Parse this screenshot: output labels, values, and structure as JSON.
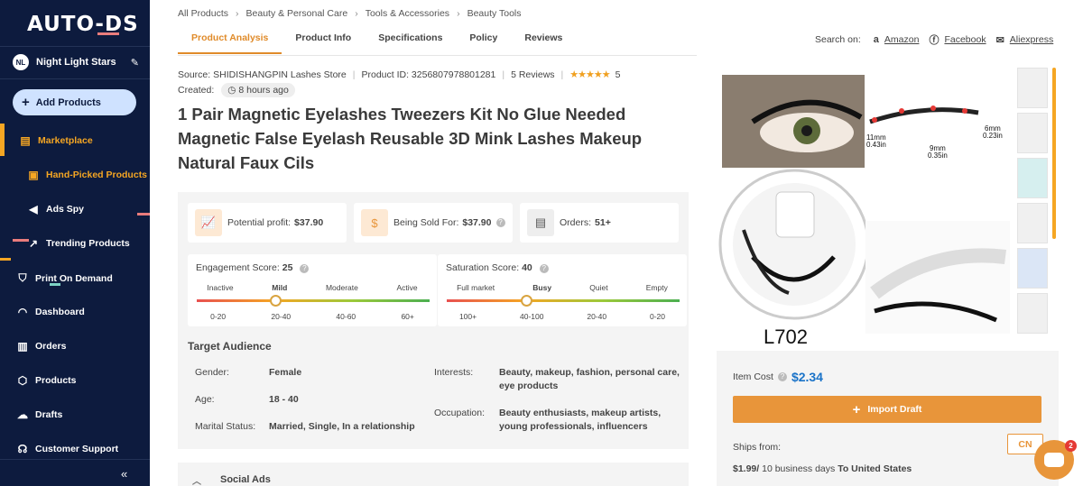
{
  "sidebar": {
    "logo": "AUTO-DS",
    "user": {
      "initials": "NL",
      "name": "Night Light Stars"
    },
    "add_products": "Add Products",
    "items": [
      {
        "label": "Marketplace",
        "icon": "store-icon"
      },
      {
        "label": "Hand-Picked Products",
        "icon": "box-star-icon"
      },
      {
        "label": "Ads Spy",
        "icon": "megaphone-icon"
      },
      {
        "label": "Trending Products",
        "icon": "trend-icon"
      },
      {
        "label": "Print On Demand",
        "icon": "shirt-icon"
      },
      {
        "label": "Dashboard",
        "icon": "gauge-icon"
      },
      {
        "label": "Orders",
        "icon": "orders-icon"
      },
      {
        "label": "Products",
        "icon": "cube-icon"
      },
      {
        "label": "Drafts",
        "icon": "cloud-upload-icon"
      },
      {
        "label": "Customer Support",
        "icon": "headset-icon"
      }
    ],
    "collapse": "«"
  },
  "breadcrumbs": [
    "All Products",
    "Beauty & Personal Care",
    "Tools & Accessories",
    "Beauty Tools"
  ],
  "tabs": [
    "Product Analysis",
    "Product Info",
    "Specifications",
    "Policy",
    "Reviews"
  ],
  "search_on": {
    "label": "Search on:",
    "links": [
      "Amazon",
      "Facebook",
      "Aliexpress"
    ]
  },
  "product": {
    "source": "Source: SHIDISHANGPIN Lashes Store",
    "product_id": "Product ID: 3256807978801281",
    "reviews": "5 Reviews",
    "rating": "5",
    "created_label": "Created:",
    "created_value": "8 hours ago",
    "title": "1 Pair Magnetic Eyelashes Tweezers Kit No Glue Needed Magnetic False Eyelash Reusable 3D Mink Lashes Makeup Natural Faux Cils"
  },
  "stats": {
    "profit_label": "Potential profit:",
    "profit_value": "$37.90",
    "sold_label": "Being Sold For:",
    "sold_value": "$37.90",
    "orders_label": "Orders:",
    "orders_value": "51+"
  },
  "engagement": {
    "label": "Engagement Score:",
    "value": "25",
    "levels": [
      "Inactive",
      "Mild",
      "Moderate",
      "Active"
    ],
    "ranges": [
      "0-20",
      "20-40",
      "40-60",
      "60+"
    ],
    "active_index": 1
  },
  "saturation": {
    "label": "Saturation Score:",
    "value": "40",
    "levels": [
      "Full market",
      "Busy",
      "Quiet",
      "Empty"
    ],
    "ranges": [
      "100+",
      "40-100",
      "20-40",
      "0-20"
    ],
    "active_index": 1
  },
  "audience": {
    "title": "Target Audience",
    "gender_label": "Gender:",
    "gender": "Female",
    "age_label": "Age:",
    "age": "18 - 40",
    "marital_label": "Marital Status:",
    "marital": "Married, Single, In a relationship",
    "interests_label": "Interests:",
    "interests": "Beauty, makeup, fashion, personal care, eye products",
    "occupation_label": "Occupation:",
    "occupation": "Beauty enthusiasts, makeup artists, young professionals, influencers"
  },
  "social_ads": "Social Ads",
  "gallery": {
    "label_11mm": "11mm",
    "label_043": "0.43in",
    "label_9mm": "9mm",
    "label_035": "0.35in",
    "label_6mm": "6mm",
    "label_023": "0.23in",
    "model_code": "L702"
  },
  "purchase": {
    "item_cost_label": "Item Cost",
    "item_cost": "$2.34",
    "import_label": "Import Draft",
    "ships_from": "Ships from:",
    "country": "CN",
    "shipping_price": "$1.99/",
    "shipping_time": "10 business days",
    "shipping_to": "To United States"
  },
  "chat_badge": "2"
}
